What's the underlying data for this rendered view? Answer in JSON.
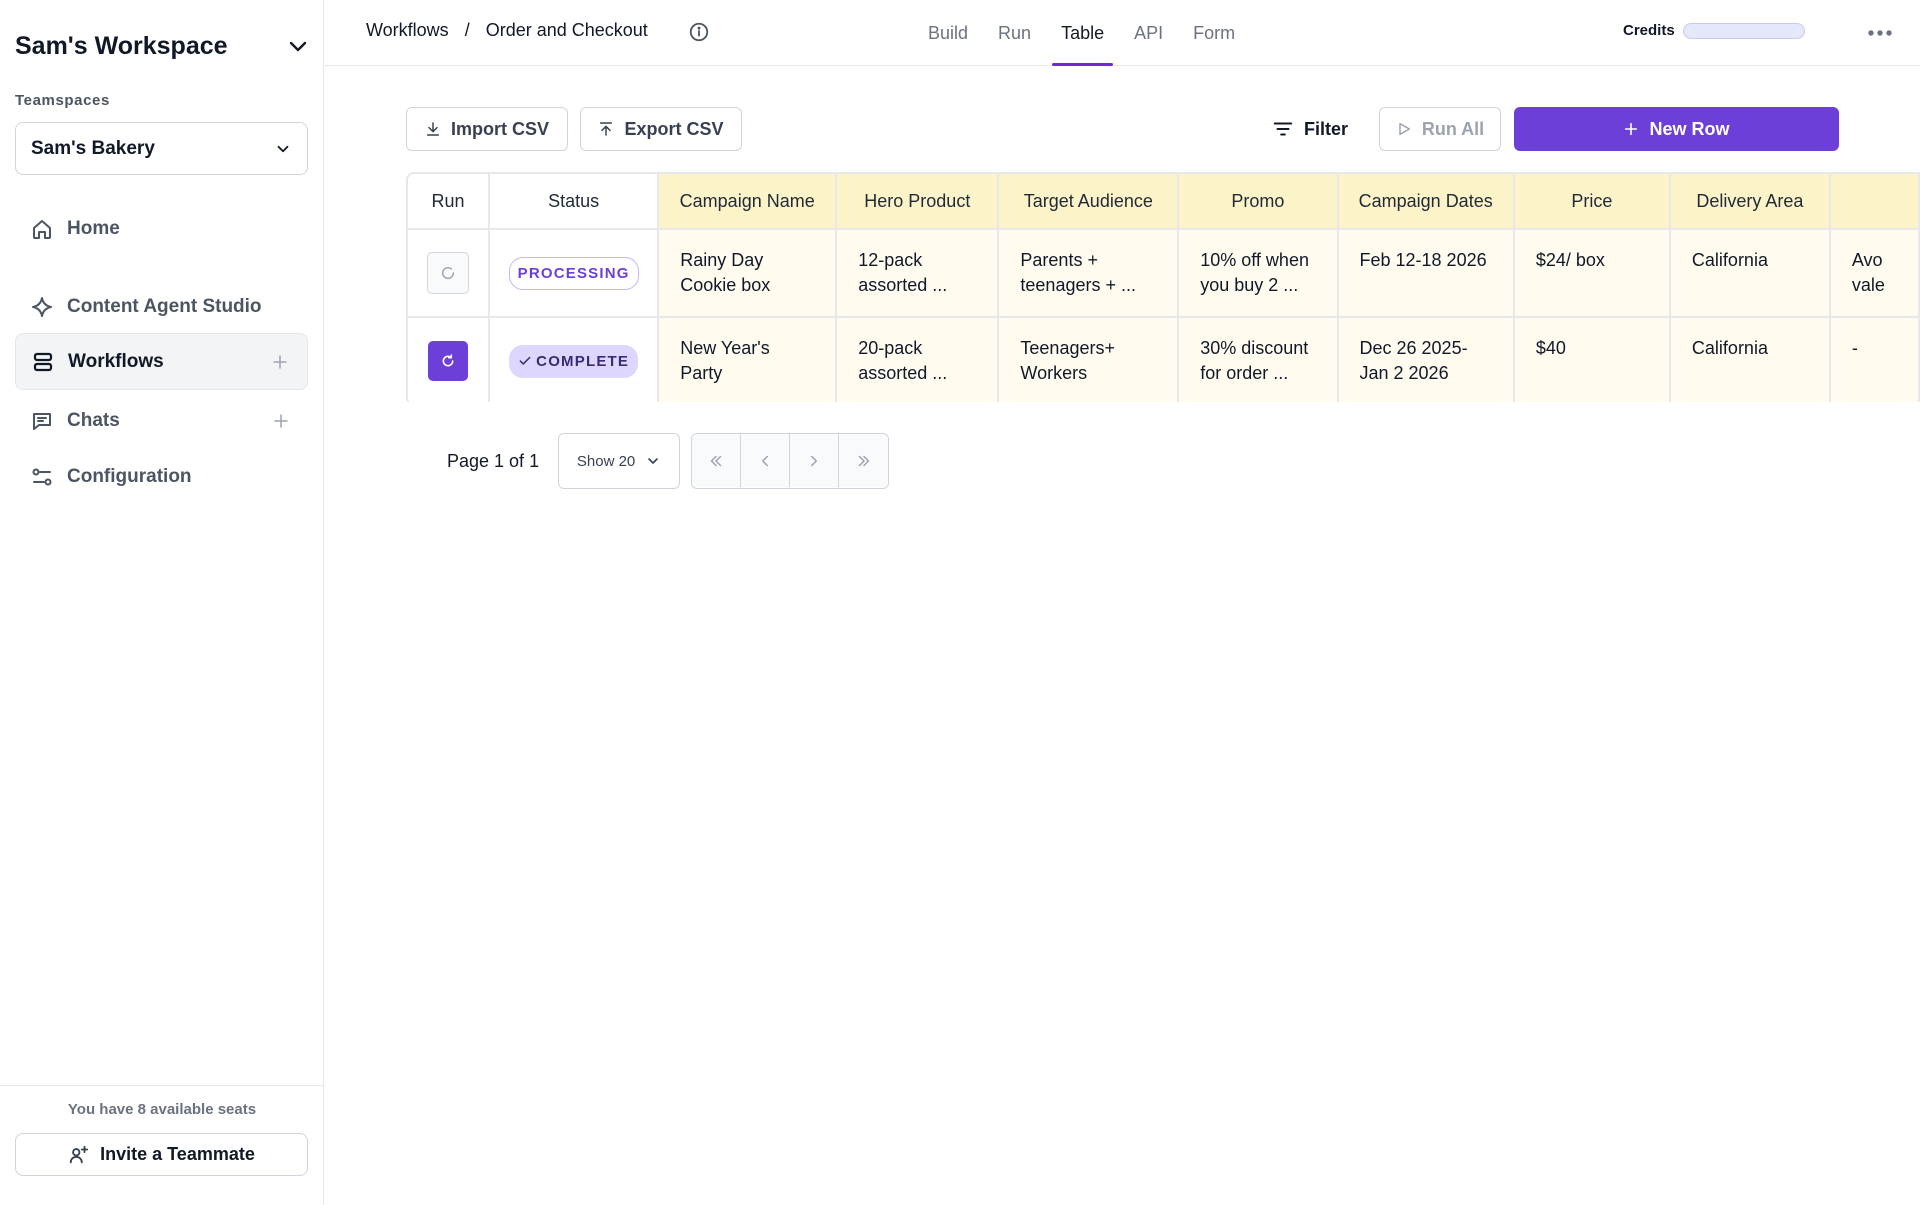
{
  "sidebar": {
    "workspace_title": "Sam's Workspace",
    "teamspaces_label": "Teamspaces",
    "teamspace_selected": "Sam's Bakery",
    "items": [
      {
        "label": "Home",
        "icon": "home-icon"
      },
      {
        "label": "Content Agent Studio",
        "icon": "sparkle-icon"
      },
      {
        "label": "Workflows",
        "icon": "stack-icon"
      },
      {
        "label": "Chats",
        "icon": "chat-icon"
      },
      {
        "label": "Configuration",
        "icon": "sliders-icon"
      }
    ],
    "seats_text": "You have 8 available seats",
    "invite_label": "Invite a Teammate"
  },
  "topbar": {
    "breadcrumb": [
      "Workflows",
      "/",
      "Order and Checkout"
    ],
    "tabs": [
      "Build",
      "Run",
      "Table",
      "API",
      "Form"
    ],
    "active_tab": "Table",
    "credits_label": "Credits",
    "credits_fill": 0.0
  },
  "toolbar": {
    "import_label": "Import CSV",
    "export_label": "Export CSV",
    "filter_label": "Filter",
    "run_all_label": "Run All",
    "new_row_label": "New Row"
  },
  "table": {
    "columns": [
      "Run",
      "Status",
      "Campaign Name",
      "Hero Product",
      "Target Audience",
      "Promo",
      "Campaign Dates",
      "Price",
      "Delivery Area",
      ""
    ],
    "rows": [
      {
        "status": "PROCESSING",
        "cells": [
          "Rainy Day Cookie box",
          "12-pack assorted ...",
          "Parents + teenagers + ...",
          "10% off when you buy 2 ...",
          "Feb 12-18 2026",
          "$24/ box",
          "California",
          "Avo vale"
        ]
      },
      {
        "status": "COMPLETE",
        "cells": [
          "New Year's Party",
          "20-pack assorted ...",
          "Teenagers+ Workers",
          "30% discount for order ...",
          "Dec 26 2025- Jan 2 2026",
          "$40",
          "California",
          "-"
        ]
      }
    ]
  },
  "pagination": {
    "page_text": "Page 1 of 1",
    "show_label": "Show 20"
  },
  "colors": {
    "accent": "#6d3fd9",
    "header_bg": "#fdf3c8",
    "cell_bg": "#fffcef"
  }
}
